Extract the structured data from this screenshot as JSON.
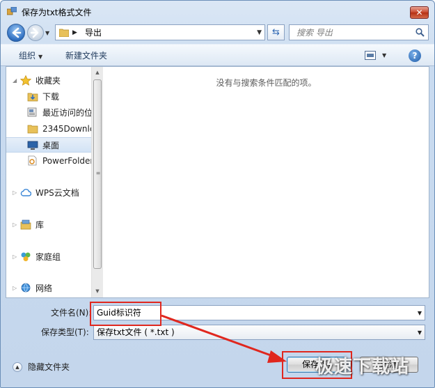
{
  "window": {
    "title": "保存为txt格式文件",
    "close_label": "✕"
  },
  "navbar": {
    "address_path": "导出",
    "search_placeholder": "搜索 导出"
  },
  "toolbar": {
    "organize_label": "组织",
    "new_folder_label": "新建文件夹",
    "help_label": "?"
  },
  "sidebar": {
    "items": [
      {
        "label": "收藏夹",
        "icon": "star-icon",
        "selected": false
      },
      {
        "label": "下载",
        "icon": "download-folder-icon",
        "selected": false
      },
      {
        "label": "最近访问的位",
        "icon": "recent-places-icon",
        "selected": false
      },
      {
        "label": "2345Downlc",
        "icon": "folder-icon",
        "selected": false
      },
      {
        "label": "桌面",
        "icon": "desktop-icon",
        "selected": true
      },
      {
        "label": "PowerFolder",
        "icon": "powerfolder-icon",
        "selected": false
      },
      {
        "label": "WPS云文档",
        "icon": "cloud-icon",
        "selected": false
      },
      {
        "label": "库",
        "icon": "library-icon",
        "selected": false
      },
      {
        "label": "家庭组",
        "icon": "homegroup-icon",
        "selected": false
      },
      {
        "label": "网络",
        "icon": "network-icon",
        "selected": false
      }
    ]
  },
  "content": {
    "empty_message": "没有与搜索条件匹配的项。"
  },
  "form": {
    "filename_label": "文件名(N):",
    "filename_value": "Guid标识符",
    "filetype_label": "保存类型(T):",
    "filetype_value": "保存txt文件 ( *.txt )"
  },
  "footer": {
    "hide_folders_label": "隐藏文件夹",
    "save_label": "保存(S)",
    "cancel_label": "取消"
  },
  "watermark": {
    "text": "极速下载站"
  },
  "colors": {
    "highlight": "#e0271e",
    "accent": "#2f6fc1"
  }
}
